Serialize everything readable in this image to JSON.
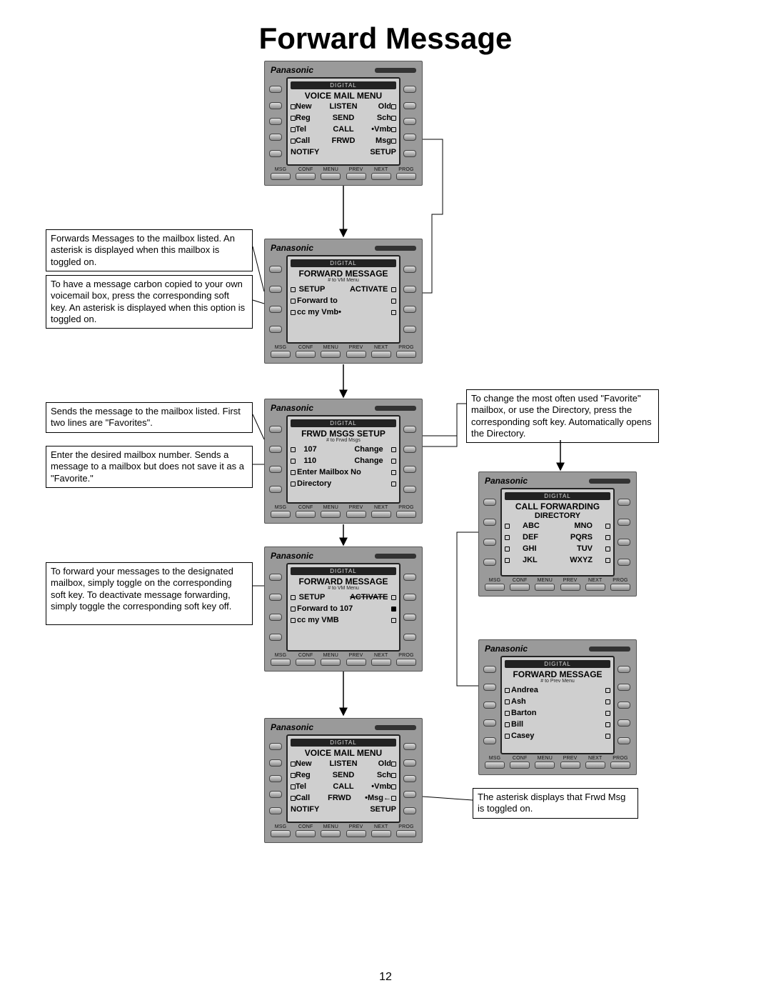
{
  "title": "Forward Message",
  "page_number": "12",
  "brand": "Panasonic",
  "topbar": "DIGITAL",
  "bottom_keys": [
    "MSG",
    "CONF",
    "MENU",
    "PREV",
    "NEXT",
    "PROG"
  ],
  "callouts": {
    "c1": "Forwards Messages to the mailbox  listed.  An asterisk is displayed when this mailbox is toggled on.",
    "c2": "To have a message carbon copied to your own voicemail box, press the corresponding soft key.  An asterisk is displayed when this option is toggled on.",
    "c3": "Sends the message to the mailbox listed. First two lines are \"Favorites\".",
    "c4": "Enter the desired mailbox number.  Sends a message to a mailbox but does not save it as a \"Favorite.\"",
    "c5": "To forward your messages to the designated mailbox, simply toggle on the corresponding soft key.  To deactivate message forwarding, simply toggle the corresponding soft key off.",
    "c6": "To change the most often used \"Favorite\" mailbox, or use the Directory, press the corresponding soft key.  Automatically opens the Directory.",
    "c7": "The asterisk displays that Frwd Msg is toggled on."
  },
  "phones": {
    "p1": {
      "header": "VOICE MAIL MENU",
      "rows": [
        {
          "l": "New",
          "c": "LISTEN",
          "r": "Old"
        },
        {
          "l": "Reg",
          "c": "SEND",
          "r": "Sch"
        },
        {
          "l": "Tel",
          "c": "CALL",
          "r": "•Vmb"
        },
        {
          "l": "Call",
          "c": "FRWD",
          "r": "Msg"
        },
        {
          "l": "NOTIFY",
          "c": "",
          "r": "SETUP"
        }
      ]
    },
    "p2": {
      "header": "FORWARD MESSAGE",
      "sub": "# to VM Menu",
      "rows": [
        {
          "l": "SETUP",
          "r": "ACTIVATE"
        },
        {
          "txt": "Forward to"
        },
        {
          "txt": "cc my Vmb•"
        }
      ]
    },
    "p3": {
      "header": "FRWD MSGS SETUP",
      "sub": "# to Frwd Msgs",
      "rows": [
        {
          "l": "107",
          "r": "Change"
        },
        {
          "l": "110",
          "r": "Change"
        },
        {
          "txt": "Enter Mailbox No"
        },
        {
          "txt": "Directory"
        }
      ]
    },
    "p4": {
      "header": "FORWARD MESSAGE",
      "sub": "# to VM Menu",
      "rows": [
        {
          "l": "SETUP",
          "r": "ACTIVATE",
          "strike": true
        },
        {
          "txt": "Forward to 107",
          "dot": true
        },
        {
          "txt": "cc my VMB"
        }
      ]
    },
    "p5": {
      "header": "VOICE MAIL MENU",
      "rows": [
        {
          "l": "New",
          "c": "LISTEN",
          "r": "Old"
        },
        {
          "l": "Reg",
          "c": "SEND",
          "r": "Sch"
        },
        {
          "l": "Tel",
          "c": "CALL",
          "r": "•Vmb"
        },
        {
          "l": "Call",
          "c": "FRWD",
          "r": "•Msg",
          "arrow": true
        },
        {
          "l": "NOTIFY",
          "c": "",
          "r": "SETUP"
        }
      ]
    },
    "p6": {
      "header": "CALL FORWARDING",
      "center": "DIRECTORY",
      "rows": [
        {
          "l": "ABC",
          "r": "MNO"
        },
        {
          "l": "DEF",
          "r": "PQRS"
        },
        {
          "l": "GHI",
          "r": "TUV"
        },
        {
          "l": "JKL",
          "r": "WXYZ"
        }
      ]
    },
    "p7": {
      "header": "FORWARD MESSAGE",
      "sub": "# to Prev Menu",
      "rows": [
        {
          "txt": "Andrea"
        },
        {
          "txt": "Ash"
        },
        {
          "txt": "Barton"
        },
        {
          "txt": "Bill"
        },
        {
          "txt": "Casey"
        }
      ]
    }
  }
}
